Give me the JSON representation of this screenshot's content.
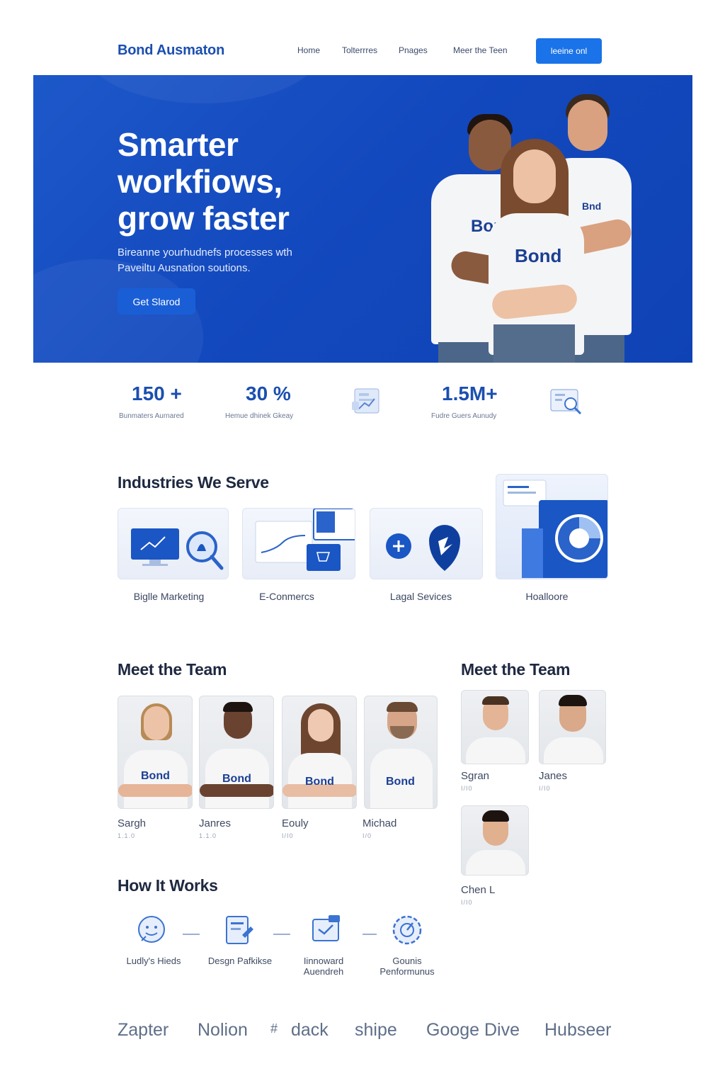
{
  "nav": {
    "brand": "Bond Ausmaton",
    "links": [
      "Home",
      "Tolterrres",
      "Pnages",
      "Meer the Teen"
    ],
    "cta": "leeine onl"
  },
  "hero": {
    "title_lines": [
      "Smarter",
      "workfiows,",
      "grow faster"
    ],
    "subtitle_lines": [
      "Bireanne yourhudnefs processes wth",
      "Paveiltu Ausnation soutions."
    ],
    "button": "Get Slarod",
    "shirt_labels": [
      "Bor",
      "Bond",
      "Bnd"
    ]
  },
  "stats": [
    {
      "value": "150 +",
      "label": "Bunmaters Aurnared"
    },
    {
      "value": "30 %",
      "label": "Hemue dhinek Gkeay"
    },
    {
      "value": "1.5M+",
      "label": "Fudre Guers Aunudy"
    }
  ],
  "industries": {
    "title": "Industries We Serve",
    "items": [
      "Biglle Marketing",
      "E-Conmercs",
      "Lagal Sevices",
      "Hoalloore"
    ]
  },
  "team": {
    "title": "Meet the Team",
    "members": [
      {
        "name": "Sargh",
        "role": "1.1.0"
      },
      {
        "name": "Janres",
        "role": "1.1.0"
      },
      {
        "name": "Eouly",
        "role": "I/I0"
      },
      {
        "name": "Michad",
        "role": "I/0"
      }
    ],
    "shirt_label": "Bond"
  },
  "team_side": {
    "title": "Meet the Team",
    "members": [
      {
        "name": "Sgran",
        "role": "I/I0"
      },
      {
        "name": "Janes",
        "role": "I/I0"
      },
      {
        "name": "Chen L",
        "role": "I/I0"
      }
    ]
  },
  "how": {
    "title": "How It Works",
    "steps": [
      [
        "Ludly's Hieds"
      ],
      [
        "Desgn Pafkikse"
      ],
      [
        "Iinnoward",
        "Auendreh"
      ],
      [
        "Gounis",
        "Penformunus"
      ]
    ]
  },
  "logos": [
    "Zapter",
    "Nolion",
    "dack",
    "shipe",
    "Googe Dive",
    "Hubseer"
  ],
  "colors": {
    "brand": "#1b4fb0",
    "hero": "#1349be",
    "accent": "#1a73e8"
  }
}
